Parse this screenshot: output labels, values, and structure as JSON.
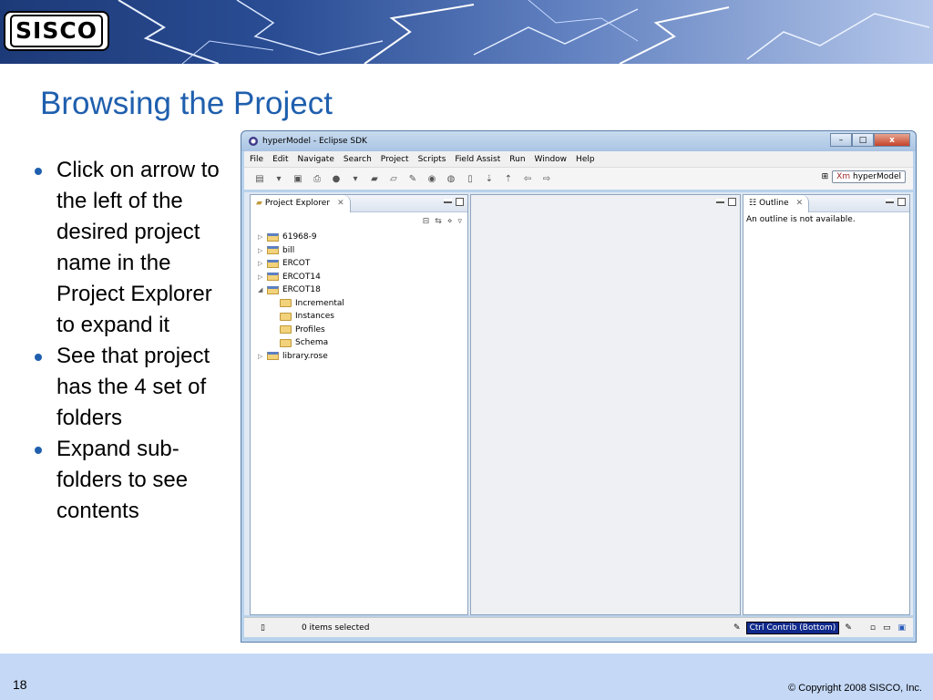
{
  "logo": {
    "text": "SISCO"
  },
  "slide": {
    "title": "Browsing the Project",
    "bullets": [
      "Click on arrow to the left of the desired project name in the Project Explorer to expand it",
      "See that project has the 4 set of folders",
      "Expand sub-folders to see contents"
    ],
    "page_number": "18",
    "copyright": "© Copyright 2008 SISCO, Inc."
  },
  "window": {
    "title": "hyperModel - Eclipse SDK",
    "controls": [
      "–",
      "□",
      "x"
    ],
    "menu": [
      "File",
      "Edit",
      "Navigate",
      "Search",
      "Project",
      "Scripts",
      "Field Assist",
      "Run",
      "Window",
      "Help"
    ],
    "perspective": {
      "prefix": "Xm",
      "label": "hyperModel"
    }
  },
  "project_explorer": {
    "tab_label": "Project Explorer",
    "items": [
      {
        "label": "61968-9",
        "arrow": "▷"
      },
      {
        "label": "bill",
        "arrow": "▷"
      },
      {
        "label": "ERCOT",
        "arrow": "▷"
      },
      {
        "label": "ERCOT14",
        "arrow": "▷"
      },
      {
        "label": "ERCOT18",
        "arrow": "◢"
      }
    ],
    "children": [
      "Incremental",
      "Instances",
      "Profiles",
      "Schema"
    ],
    "last_item": {
      "label": "library.rose",
      "arrow": "▷"
    }
  },
  "outline": {
    "tab_label": "Outline",
    "message": "An outline is not available."
  },
  "statusbar": {
    "selection": "0 items selected",
    "contrib": "Ctrl Contrib (Bottom)"
  }
}
